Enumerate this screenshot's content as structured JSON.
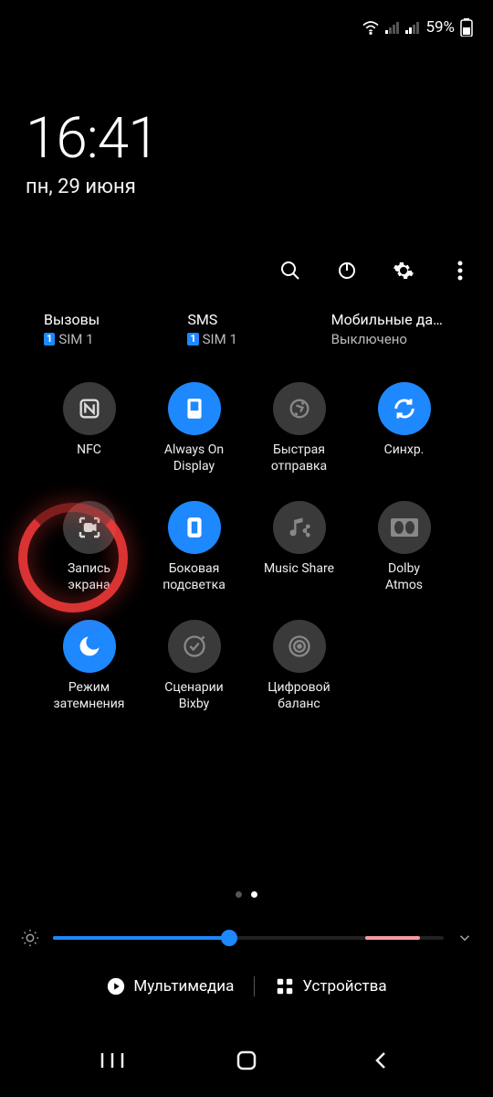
{
  "status": {
    "battery_text": "59%"
  },
  "clock": {
    "time": "16:41",
    "date": "пн, 29 июня"
  },
  "connectivity": {
    "calls": {
      "label": "Вызовы",
      "sim_badge": "1",
      "sim_text": "SIM 1"
    },
    "sms": {
      "label": "SMS",
      "sim_badge": "1",
      "sim_text": "SIM 1"
    },
    "mobile_data": {
      "label": "Мобильные да…",
      "sub": "Выключено"
    }
  },
  "toggles": [
    {
      "id": "nfc",
      "label1": "NFC",
      "label2": "",
      "on": false
    },
    {
      "id": "aod",
      "label1": "Always On",
      "label2": "Display",
      "on": true
    },
    {
      "id": "quickshare",
      "label1": "Быстрая",
      "label2": "отправка",
      "on": false
    },
    {
      "id": "sync",
      "label1": "Синхр.",
      "label2": "",
      "on": true
    },
    {
      "id": "screenrec",
      "label1": "Запись",
      "label2": "экрана",
      "on": false
    },
    {
      "id": "edgelight",
      "label1": "Боковая",
      "label2": "подсветка",
      "on": true
    },
    {
      "id": "musicshare",
      "label1": "Music Share",
      "label2": "",
      "on": false
    },
    {
      "id": "dolby",
      "label1": "Dolby",
      "label2": "Atmos",
      "on": false
    },
    {
      "id": "darkmode",
      "label1": "Режим",
      "label2": "затемнения",
      "on": true
    },
    {
      "id": "bixby",
      "label1": "Сценарии",
      "label2": "Bixby",
      "on": false
    },
    {
      "id": "wellbeing",
      "label1": "Цифровой",
      "label2": "баланс",
      "on": false
    }
  ],
  "bottom": {
    "media_label": "Мультимедиа",
    "devices_label": "Устройства"
  },
  "colors": {
    "accent": "#1e88ff",
    "offCircle": "#3a3a3a"
  }
}
